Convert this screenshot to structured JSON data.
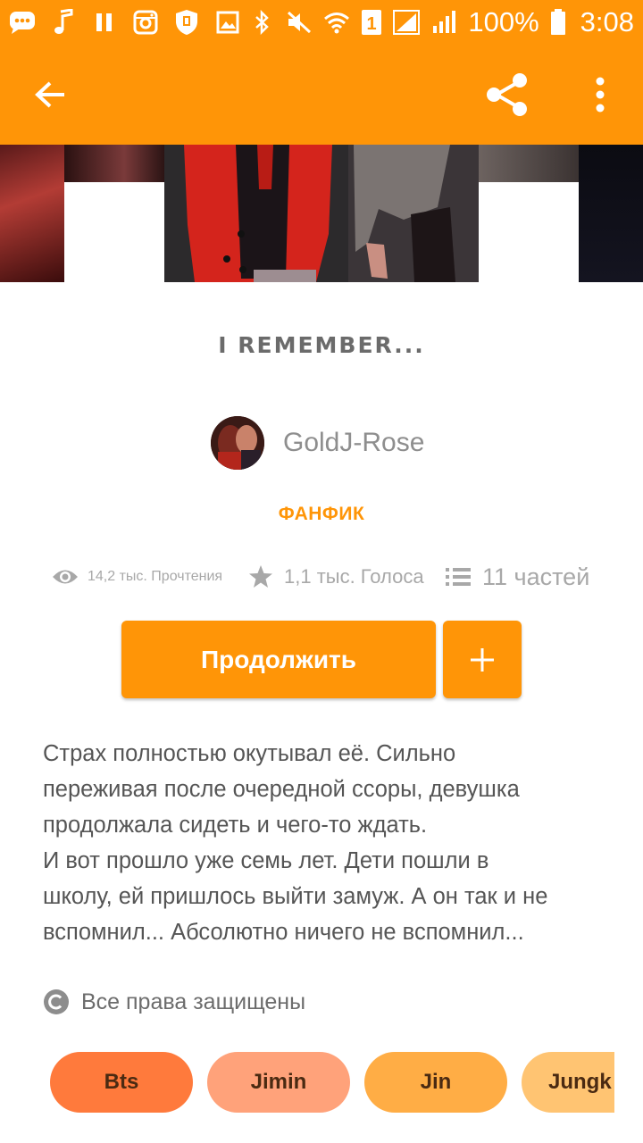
{
  "status_bar": {
    "battery": "100%",
    "time": "3:08",
    "sim_slot": "1",
    "icons": [
      "chat-icon",
      "music-icon",
      "pause-icon",
      "instagram-icon",
      "shield-icon",
      "image-icon",
      "bluetooth-icon",
      "mute-icon",
      "wifi-icon",
      "sim-icon",
      "signal-icon",
      "battery-icon"
    ]
  },
  "toolbar": {
    "back_icon": "arrow-back-icon",
    "share_icon": "share-icon",
    "more_icon": "more-vert-icon"
  },
  "story": {
    "title": "I REMEMBER...",
    "author": "GoldJ-Rose",
    "genre": "ФАНФИК",
    "reads": "14,2 тыс. Прочтения",
    "votes": "1,1 тыс. Голоса",
    "parts": "11 частей",
    "continue_label": "Продолжить",
    "add_label": "+",
    "description_lines": [
      "Страх полностью окутывал её. Сильно",
      "переживая после очередной ссоры, девушка",
      "продолжала сидеть и чего-то ждать.",
      "И вот прошло уже семь лет. Дети пошли в",
      "школу, ей пришлось выйти замуж. А он так и не",
      "вспомнил... Абсолютно ничего не вспомнил..."
    ],
    "copyright": "Все права защищены",
    "tags": [
      "Bts",
      "Jimin",
      "Jin",
      "Jungk"
    ]
  },
  "colors": {
    "accent": "#ff9507",
    "tag_colors": [
      "#ff7a3c",
      "#ffa27a",
      "#ffad45",
      "#ffc472"
    ]
  }
}
